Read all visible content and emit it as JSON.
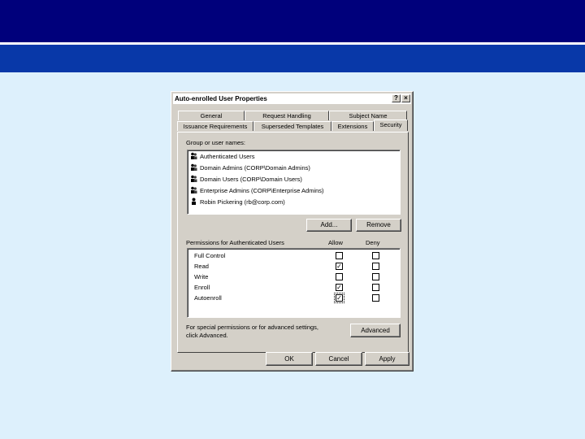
{
  "dialog": {
    "title": "Auto-enrolled User Properties",
    "help_label": "?",
    "close_label": "×",
    "tabs_row1": [
      {
        "label": "General"
      },
      {
        "label": "Request Handling"
      },
      {
        "label": "Subject Name"
      }
    ],
    "tabs_row2": [
      {
        "label": "Issuance Requirements"
      },
      {
        "label": "Superseded Templates"
      },
      {
        "label": "Extensions"
      },
      {
        "label": "Security"
      }
    ],
    "groups_label": "Group or user names:",
    "groups": [
      {
        "name": "Authenticated Users",
        "icon": "group-icon"
      },
      {
        "name": "Domain Admins (CORP\\Domain Admins)",
        "icon": "group-icon"
      },
      {
        "name": "Domain Users (CORP\\Domain Users)",
        "icon": "group-icon"
      },
      {
        "name": "Enterprise Admins (CORP\\Enterprise Admins)",
        "icon": "group-icon"
      },
      {
        "name": "Robin Pickering (rb@corp.com)",
        "icon": "user-icon"
      }
    ],
    "add_label": "Add...",
    "remove_label": "Remove",
    "permissions_label": "Permissions for Authenticated Users",
    "allow_label": "Allow",
    "deny_label": "Deny",
    "permissions": [
      {
        "name": "Full Control",
        "allow": false,
        "deny": false
      },
      {
        "name": "Read",
        "allow": true,
        "deny": false
      },
      {
        "name": "Write",
        "allow": false,
        "deny": false
      },
      {
        "name": "Enroll",
        "allow": true,
        "deny": false
      },
      {
        "name": "Autoenroll",
        "allow": true,
        "deny": false
      }
    ],
    "advanced_text_line1": "For special permissions or for advanced settings,",
    "advanced_text_line2": "click Advanced.",
    "advanced_label": "Advanced",
    "ok_label": "OK",
    "cancel_label": "Cancel",
    "apply_label": "Apply"
  },
  "colors": {
    "background": "#ddf0fc",
    "band_dark": "#00007b",
    "band_mid": "#0838a8",
    "dialog_face": "#d4d0c8"
  }
}
